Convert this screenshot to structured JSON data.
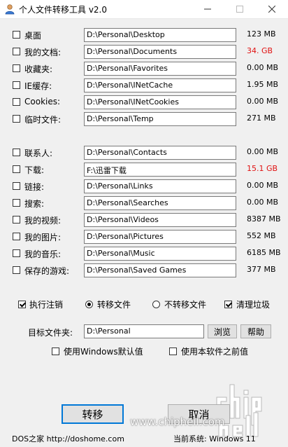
{
  "window": {
    "title": "个人文件转移工具 v2.0"
  },
  "folders_group1": [
    {
      "label": "桌面",
      "path": "D:\\Personal\\Desktop",
      "size": "123  MB",
      "checked": false,
      "warn": false
    },
    {
      "label": "我的文档:",
      "path": "D:\\Personal\\Documents",
      "size": "34.  GB",
      "checked": false,
      "warn": true
    },
    {
      "label": "收藏夹:",
      "path": "D:\\Personal\\Favorites",
      "size": "0.00 MB",
      "checked": false,
      "warn": false
    },
    {
      "label": "IE缓存:",
      "path": "D:\\Personal\\INetCache",
      "size": "1.95 MB",
      "checked": false,
      "warn": false
    },
    {
      "label": "Cookies:",
      "path": "D:\\Personal\\INetCookies",
      "size": "0.00 MB",
      "checked": false,
      "warn": false
    },
    {
      "label": "临时文件:",
      "path": "D:\\Personal\\Temp",
      "size": "271  MB",
      "checked": false,
      "warn": false
    }
  ],
  "folders_group2": [
    {
      "label": "联系人:",
      "path": "D:\\Personal\\Contacts",
      "size": "0.00 MB",
      "checked": false,
      "warn": false
    },
    {
      "label": "下载:",
      "path": "F:\\迅雷下载",
      "size": "15.1 GB",
      "checked": false,
      "warn": true
    },
    {
      "label": "链接:",
      "path": "D:\\Personal\\Links",
      "size": "0.00 MB",
      "checked": false,
      "warn": false
    },
    {
      "label": "搜索:",
      "path": "D:\\Personal\\Searches",
      "size": "0.00 MB",
      "checked": false,
      "warn": false
    },
    {
      "label": "我的视频:",
      "path": "D:\\Personal\\Videos",
      "size": "8387 MB",
      "checked": false,
      "warn": false
    },
    {
      "label": "我的图片:",
      "path": "D:\\Personal\\Pictures",
      "size": "552  MB",
      "checked": false,
      "warn": false
    },
    {
      "label": "我的音乐:",
      "path": "D:\\Personal\\Music",
      "size": "6185 MB",
      "checked": false,
      "warn": false
    },
    {
      "label": "保存的游戏:",
      "path": "D:\\Personal\\Saved Games",
      "size": "377  MB",
      "checked": false,
      "warn": false
    }
  ],
  "options": {
    "run_logoff": {
      "label": "执行注销",
      "checked": true
    },
    "transfer_files": {
      "label": "转移文件",
      "selected": true
    },
    "no_transfer": {
      "label": "不转移文件",
      "selected": false
    },
    "clean_junk": {
      "label": "清理垃圾",
      "checked": true
    }
  },
  "target": {
    "label": "目标文件夹:",
    "value": "D:\\Personal",
    "browse": "浏览",
    "help": "帮助"
  },
  "defaults": {
    "windows_default": {
      "label": "使用Windows默认值",
      "checked": false
    },
    "previous_value": {
      "label": "使用本软件之前值",
      "checked": false
    }
  },
  "actions": {
    "transfer": "转移",
    "cancel": "取消"
  },
  "footer": {
    "credit": "DOS之家 http://doshome.com",
    "system": "当前系统:  Windows 11"
  },
  "watermark": {
    "url": "www.chiphell.com"
  },
  "colors": {
    "warn": "#e01010",
    "accent": "#0078d7"
  }
}
